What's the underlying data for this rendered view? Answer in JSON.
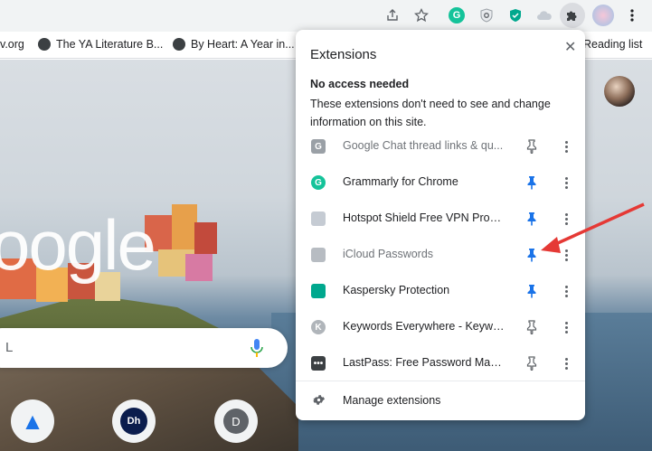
{
  "toolbar": {
    "icons": [
      "share-icon",
      "bookmark-star-icon",
      "grammarly-icon",
      "hotspot-shield-icon",
      "kaspersky-icon",
      "icloud-icon",
      "extensions-puzzle-icon",
      "profile-icon",
      "menu-icon"
    ]
  },
  "bookmarks": {
    "items": [
      {
        "label": "v.org"
      },
      {
        "label": "The YA Literature B..."
      },
      {
        "label": "By Heart: A Year in..."
      }
    ],
    "reading_list": "Reading list"
  },
  "ntp": {
    "logo_text": "oogle",
    "search_placeholder": "L",
    "shortcuts": [
      {
        "label": "▲"
      },
      {
        "label": "Dh"
      },
      {
        "label": "D"
      }
    ]
  },
  "popup": {
    "title": "Extensions",
    "close": "✕",
    "section_title": "No access needed",
    "section_desc": "These extensions don't need to see and change information on this site.",
    "extensions": [
      {
        "name": "Google Chat thread links & qu...",
        "icon_letter": "G",
        "icon_color": "#9aa0a6",
        "pinned": false,
        "dim": true
      },
      {
        "name": "Grammarly for Chrome",
        "icon_letter": "G",
        "icon_color": "#15c39a",
        "pinned": true,
        "dim": false
      },
      {
        "name": "Hotspot Shield Free VPN Proxy...",
        "icon_letter": "",
        "icon_color": "#c5cbd3",
        "pinned": true,
        "dim": false
      },
      {
        "name": "iCloud Passwords",
        "icon_letter": "",
        "icon_color": "#b7bcc2",
        "pinned": true,
        "dim": true
      },
      {
        "name": "Kaspersky Protection",
        "icon_letter": "",
        "icon_color": "#00a88e",
        "pinned": true,
        "dim": false
      },
      {
        "name": "Keywords Everywhere - Keywor...",
        "icon_letter": "K",
        "icon_color": "#b0b5ba",
        "pinned": false,
        "dim": false
      },
      {
        "name": "LastPass: Free Password Manager",
        "icon_letter": "•••",
        "icon_color": "#3c4043",
        "pinned": false,
        "dim": false
      }
    ],
    "manage_label": "Manage extensions"
  },
  "colors": {
    "pin_active": "#1a73e8",
    "pin_inactive": "#5f6368",
    "annotation_arrow": "#e53935"
  }
}
